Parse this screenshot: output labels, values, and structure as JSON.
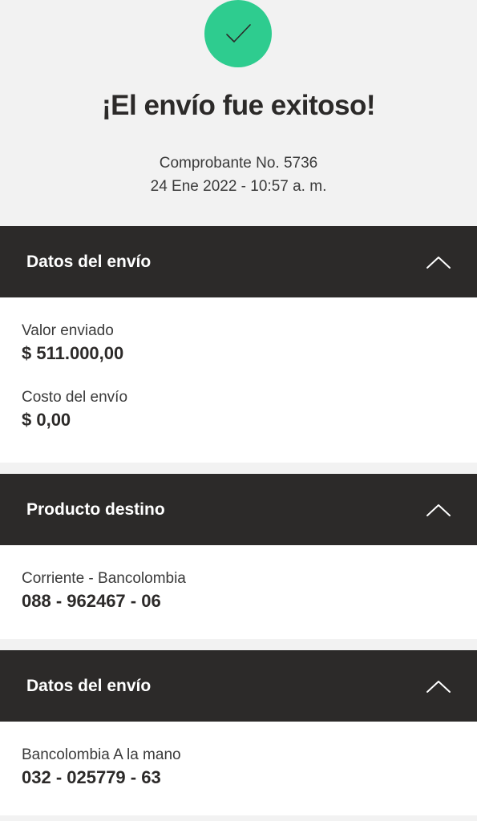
{
  "header": {
    "icon": "check-icon",
    "accent_color": "#2ecc8f",
    "title": "¡El envío fue exitoso!",
    "receipt": "Comprobante No. 5736",
    "datetime": "24 Ene 2022 - 10:57 a. m."
  },
  "sections": [
    {
      "title": "Datos del envío",
      "icon": "chevron-up-icon",
      "fields": [
        {
          "label": "Valor enviado",
          "value": "$ 511.000,00"
        },
        {
          "label": "Costo del envío",
          "value": "$ 0,00"
        }
      ]
    },
    {
      "title": "Producto destino",
      "icon": "chevron-up-icon",
      "fields": [
        {
          "label": "Corriente - Bancolombia",
          "value": "088 - 962467 - 06"
        }
      ]
    },
    {
      "title": "Datos del envío",
      "icon": "chevron-up-icon",
      "fields": [
        {
          "label": "Bancolombia A la mano",
          "value": "032 - 025779 - 63"
        }
      ]
    }
  ]
}
